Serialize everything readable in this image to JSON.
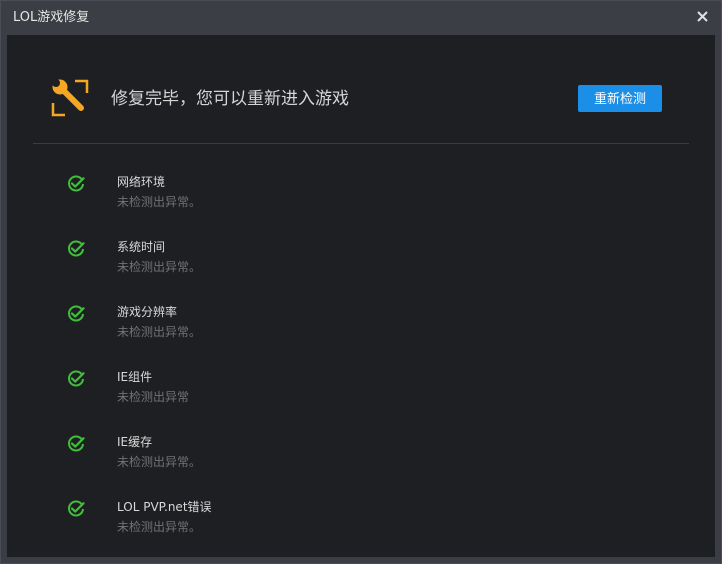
{
  "window": {
    "title": "LOL游戏修复"
  },
  "header": {
    "icon": "wrench-icon",
    "message": "修复完毕，您可以重新进入游戏",
    "recheck_label": "重新检测"
  },
  "colors": {
    "accent": "#1b8fe8",
    "success": "#3fbf3a",
    "icon_orange": "#f5a623",
    "background": "#1e1f22"
  },
  "checks": [
    {
      "name": "网络环境",
      "result": "未检测出异常。"
    },
    {
      "name": "系统时间",
      "result": "未检测出异常。"
    },
    {
      "name": "游戏分辨率",
      "result": "未检测出异常。"
    },
    {
      "name": "IE组件",
      "result": "未检测出异常"
    },
    {
      "name": "IE缓存",
      "result": "未检测出异常。"
    },
    {
      "name": "LOL PVP.net错误",
      "result": "未检测出异常。"
    }
  ]
}
